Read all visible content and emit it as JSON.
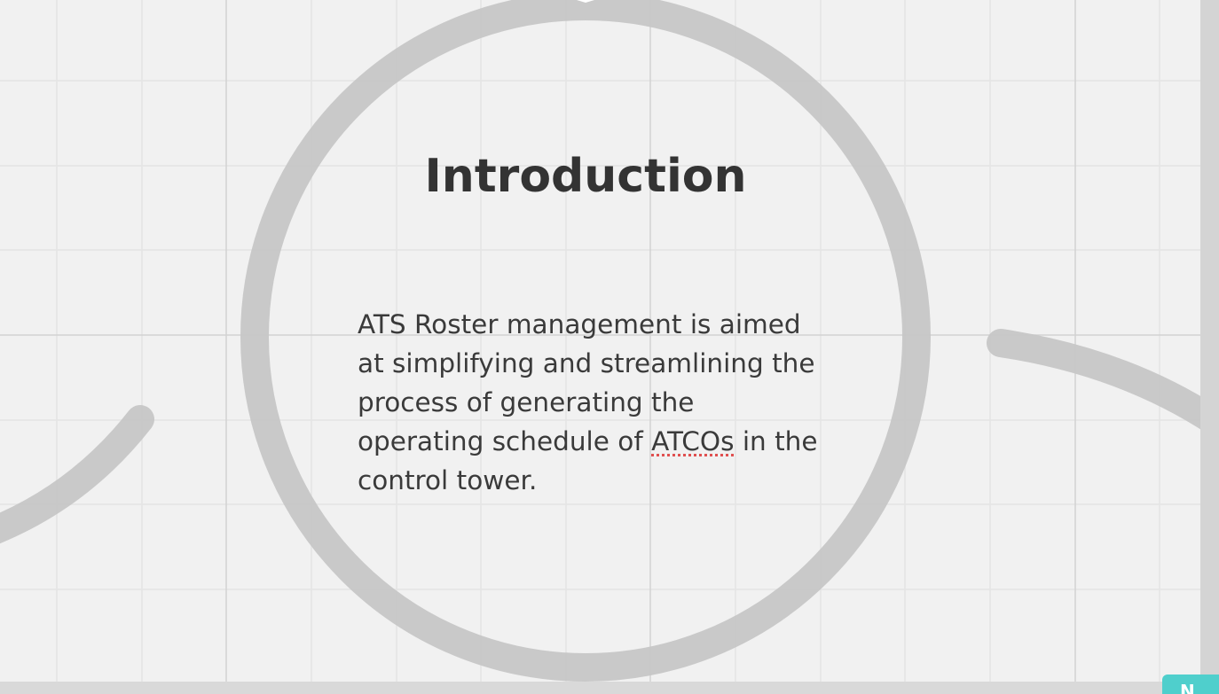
{
  "slide": {
    "title": "Introduction",
    "body_before": "ATS Roster management is aimed at simplifying and streamlining the process of generating the operating schedule of ",
    "body_flagged_word": "ATCOs",
    "body_after": " in the control tower."
  },
  "new_button": {
    "label": "N"
  },
  "colors": {
    "background": "#f1f1f1",
    "grid_line": "#e2e2e2",
    "arc_stroke": "#c4c4c4",
    "text": "#333333",
    "accent": "#4fcfcc"
  }
}
